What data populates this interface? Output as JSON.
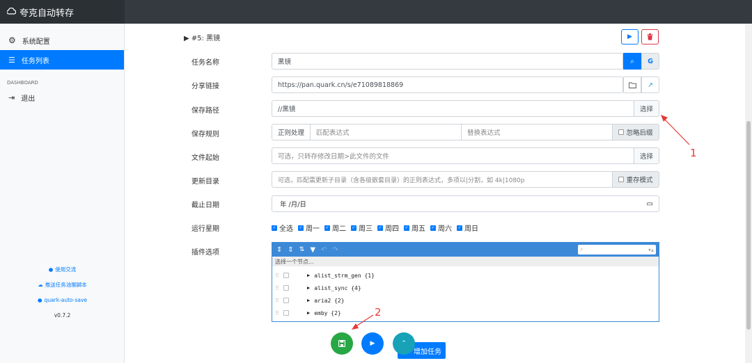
{
  "app": {
    "title": "夸克自动转存"
  },
  "sidebar": {
    "items": [
      {
        "label": "系统配置",
        "icon": "gear-icon"
      },
      {
        "label": "任务列表",
        "icon": "list-icon",
        "active": true
      }
    ],
    "section_heading": "DASHBOARD",
    "logout_label": "退出",
    "footer_links": [
      {
        "label": "使用交流",
        "icon": "chat-icon"
      },
      {
        "label": "推送任务油猴脚本",
        "icon": "cloud-icon"
      },
      {
        "label": "quark-auto-save",
        "icon": "github-icon"
      }
    ],
    "version": "v0.7.2"
  },
  "task": {
    "title": "#5: 黑镜",
    "labels": {
      "name": "任务名称",
      "share_link": "分享链接",
      "save_path": "保存路径",
      "save_rule": "保存规则",
      "file_start": "文件起始",
      "update_dir": "更新目录",
      "deadline": "截止日期",
      "run_weekdays": "运行星期",
      "plugin_options": "插件选项"
    },
    "name_value": "黑镜",
    "share_link_value": "https://pan.quark.cn/s/e71089818869",
    "save_path_value": "//黑镜",
    "select_label": "选择",
    "regex_toggle": "正则处理",
    "match_placeholder": "匹配表达式",
    "replace_placeholder": "替换表达式",
    "ignore_ext_label": "忽略后缀",
    "file_start_placeholder": "可选，只转存修改日期>此文件的文件",
    "update_dir_placeholder": "可选，匹配需更新子目录（含各级嵌套目录）的正则表达式，多项以|分割，如 4k|1080p",
    "rename_mode_label": "重存模式",
    "date_placeholder": "年 /月/日",
    "weekdays": [
      "全选",
      "周一",
      "周二",
      "周三",
      "周四",
      "周五",
      "周六",
      "周日"
    ]
  },
  "plugins": {
    "hint": "选择一个节点...",
    "nodes": [
      "alist_strm_gen {1}",
      "alist_sync {4}",
      "aria2 {2}",
      "emby {2}"
    ]
  },
  "actions": {
    "add_task_label": "增加任务"
  },
  "annotations": [
    "1",
    "2"
  ],
  "colors": {
    "primary": "#007bff",
    "success": "#28a745",
    "info": "#17a2b8",
    "danger": "#dc3545",
    "tree_header": "#3c89d8",
    "annotation": "#e53935"
  }
}
